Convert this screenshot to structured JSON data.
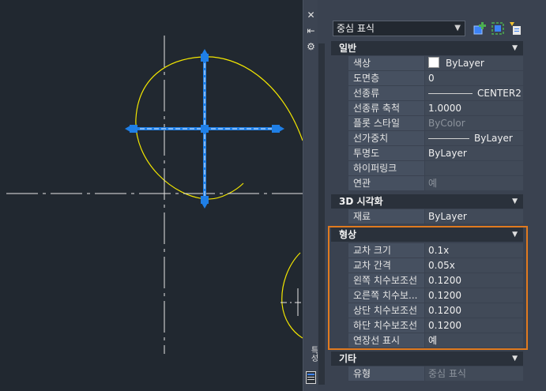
{
  "toolbar": {
    "object_type": "중심 표식",
    "quick_select_icon": "quick-select-icon",
    "select_objects_icon": "select-objects-icon",
    "toggle_pickadd_icon": "toggle-pickadd-icon"
  },
  "strip": {
    "close_icon": "✕",
    "pin_icon": "⇤",
    "settings_icon": "⚙",
    "properties_label": "특성"
  },
  "sections": {
    "general": {
      "title": "일반",
      "rows": [
        {
          "label": "색상",
          "value": "ByLayer"
        },
        {
          "label": "도면층",
          "value": "0"
        },
        {
          "label": "선종류",
          "value": "CENTER2"
        },
        {
          "label": "선종류 축척",
          "value": "1.0000"
        },
        {
          "label": "플롯 스타일",
          "value": "ByColor"
        },
        {
          "label": "선가중치",
          "value": "ByLayer"
        },
        {
          "label": "투명도",
          "value": "ByLayer"
        },
        {
          "label": "하이퍼링크",
          "value": ""
        },
        {
          "label": "연관",
          "value": "예"
        }
      ]
    },
    "visual3d": {
      "title": "3D 시각화",
      "rows": [
        {
          "label": "재료",
          "value": "ByLayer"
        }
      ]
    },
    "geometry": {
      "title": "형상",
      "rows": [
        {
          "label": "교차 크기",
          "value": "0.1x"
        },
        {
          "label": "교차 간격",
          "value": "0.05x"
        },
        {
          "label": "왼쪽 치수보조선",
          "value": "0.1200"
        },
        {
          "label": "오른쪽 치수보...",
          "value": "0.1200"
        },
        {
          "label": "상단 치수보조선",
          "value": "0.1200"
        },
        {
          "label": "하단 치수보조선",
          "value": "0.1200"
        },
        {
          "label": "연장선 표시",
          "value": "예"
        }
      ]
    },
    "misc": {
      "title": "기타",
      "rows": [
        {
          "label": "유형",
          "value": "중심 표식"
        }
      ]
    }
  },
  "colors": {
    "accent_highlight": "#e07a1f",
    "grip_blue": "#1f7fe6",
    "arc_yellow": "#f2e600",
    "canvas_bg": "#212830"
  }
}
